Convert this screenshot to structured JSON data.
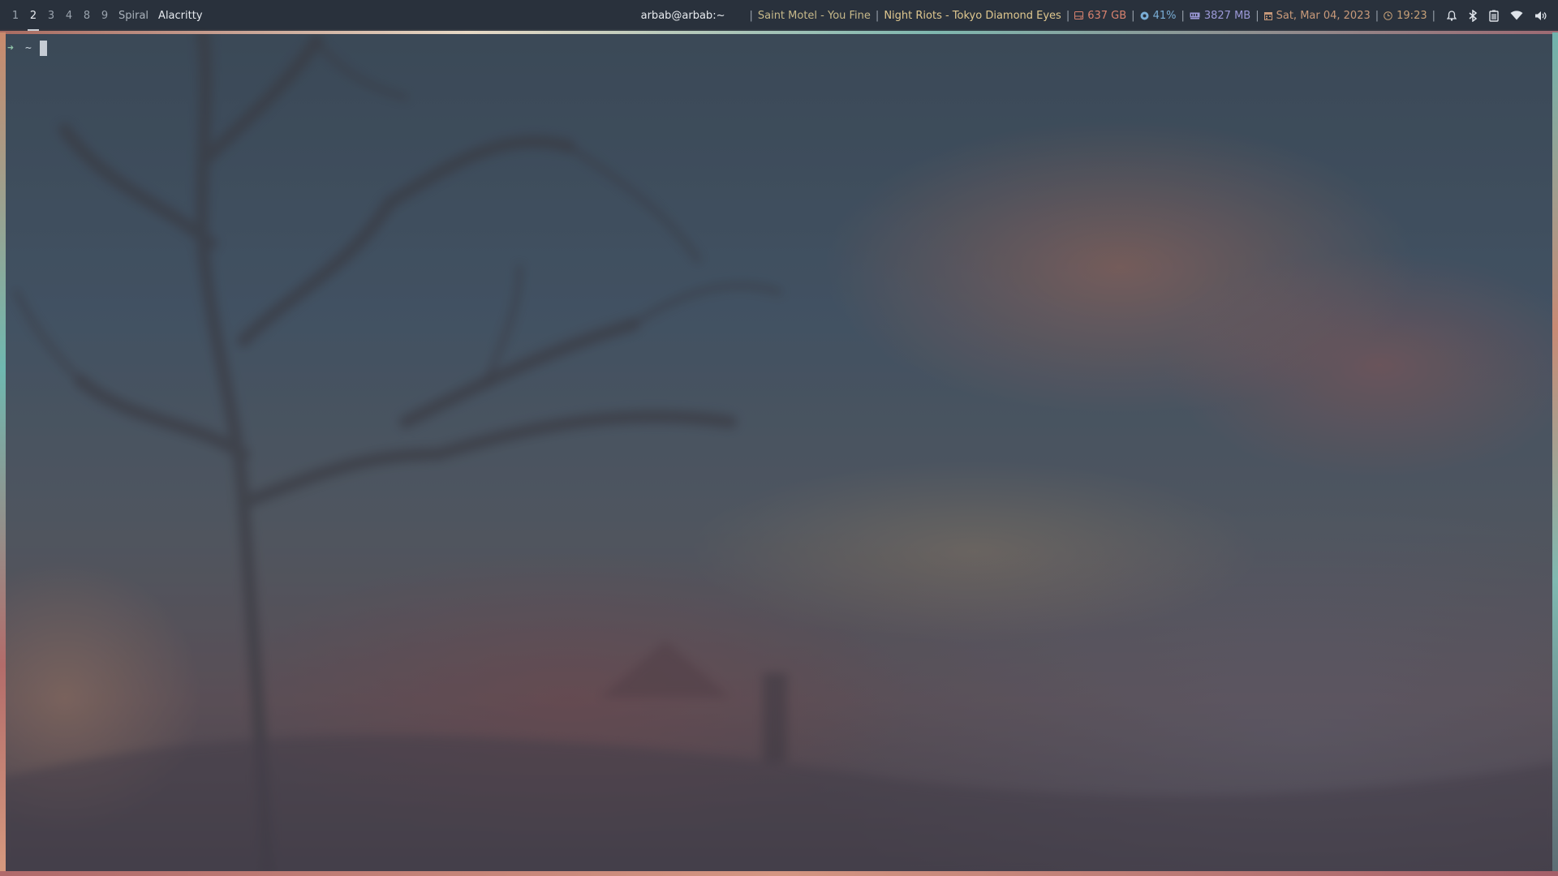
{
  "colors": {
    "bar_bg": "#282f3a",
    "disk": "#d9826f",
    "cpu": "#7aaed6",
    "memory": "#9c99d8",
    "date": "#c99a7a",
    "music": "#e0c88f"
  },
  "workspaces": [
    {
      "label": "1",
      "active": false
    },
    {
      "label": "2",
      "active": true
    },
    {
      "label": "3",
      "active": false
    },
    {
      "label": "4",
      "active": false
    },
    {
      "label": "8",
      "active": false
    },
    {
      "label": "9",
      "active": false
    }
  ],
  "layout_name": "Spiral",
  "window_title": "Alacritty",
  "hostname": "arbab@arbab:~",
  "media": {
    "previous": "Saint Motel - You Fine",
    "current": "Night Riots - Tokyo Diamond Eyes"
  },
  "modules": {
    "disk": "637 GB",
    "cpu": "41%",
    "memory": "3827 MB",
    "date": "Sat, Mar 04, 2023",
    "time": "19:23"
  },
  "separators": {
    "bar": "|"
  },
  "icons": {
    "disk": "hard-drive-icon",
    "cpu": "cpu-icon",
    "memory": "memory-icon",
    "date": "calendar-icon",
    "time": "clock-icon",
    "tray": [
      "bell-icon",
      "bluetooth-icon",
      "battery-icon",
      "wifi-icon",
      "volume-icon"
    ]
  },
  "terminal": {
    "prompt_arrow": "➜",
    "cwd": "~"
  }
}
